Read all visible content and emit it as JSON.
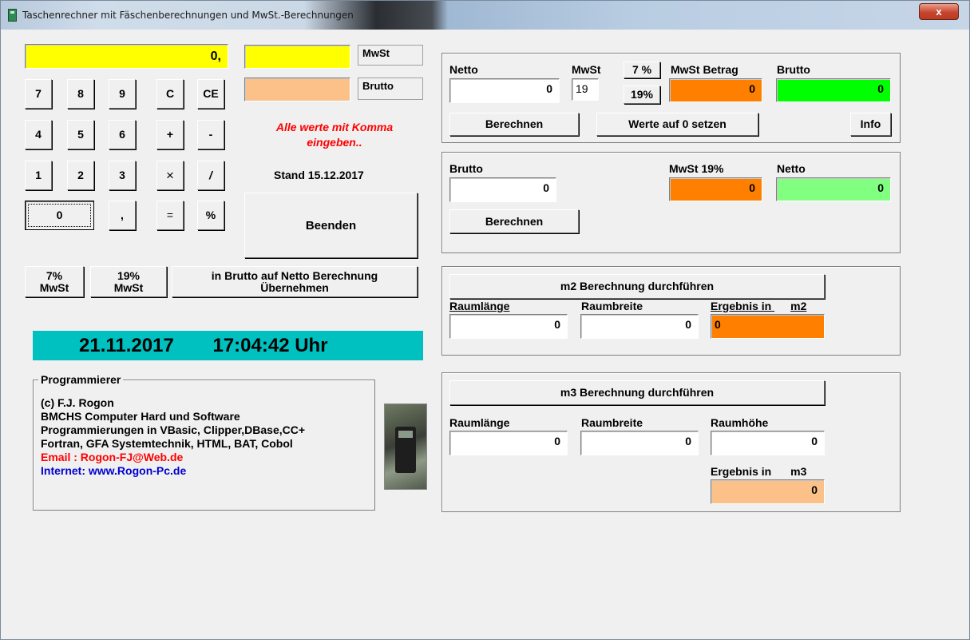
{
  "window": {
    "title": "Taschenrechner mit Fäschenberechnungen und MwSt.-Berechnungen",
    "close_glyph": "x"
  },
  "calculator": {
    "display": "0,",
    "keys": [
      "7",
      "8",
      "9",
      "C",
      "CE",
      "4",
      "5",
      "6",
      "+",
      "-",
      "1",
      "2",
      "3",
      "×",
      "/",
      "0",
      ",",
      "=",
      "%"
    ]
  },
  "side": {
    "mwst_label": "MwSt",
    "brutto_label": "Brutto",
    "note": "Alle werte mit Komma eingeben..",
    "stand": "Stand 15.12.2017",
    "beenden": "Beenden"
  },
  "quick": {
    "btn7": "7% MwSt",
    "btn19": "19% MwSt",
    "transfer": "in Brutto auf Netto Berechnung Übernehmen"
  },
  "clock": {
    "date": "21.11.2017",
    "time": "17:04:42 Uhr"
  },
  "programmer": {
    "legend": "Programmierer",
    "lines": [
      "(c) F.J. Rogon",
      "BMCHS Computer Hard und Software",
      "Programmierungen in VBasic, Clipper,DBase,CC+",
      "Fortran, GFA Systemtechnik, HTML, BAT, Cobol"
    ],
    "email": "Email   : Rogon-FJ@Web.de",
    "internet": "Internet: www.Rogon-Pc.de"
  },
  "netto_panel": {
    "netto_label": "Netto",
    "netto_value": "0",
    "mwst_label": "MwSt",
    "mwst_value": "19",
    "btn7": "7 %",
    "btn19": "19%",
    "mwst_betrag_label": "MwSt Betrag",
    "mwst_betrag_value": "0",
    "brutto_label": "Brutto",
    "brutto_value": "0",
    "berechnen": "Berechnen",
    "reset": "Werte auf 0 setzen",
    "info": "Info"
  },
  "brutto_panel": {
    "brutto_label": "Brutto",
    "brutto_value": "0",
    "mwst_label": "MwSt 19%",
    "mwst_value": "0",
    "netto_label": "Netto",
    "netto_value": "0",
    "berechnen": "Berechnen"
  },
  "m2_panel": {
    "button": "m2 Berechnung durchführen",
    "laenge_label": "Raumlänge",
    "laenge_value": "0",
    "breite_label": "Raumbreite",
    "breite_value": "0",
    "ergebnis_label": "Ergebnis in",
    "unit": "m2",
    "ergebnis_value": "0"
  },
  "m3_panel": {
    "button": "m3 Berechnung durchführen",
    "laenge_label": "Raumlänge",
    "laenge_value": "0",
    "breite_label": "Raumbreite",
    "breite_value": "0",
    "hoehe_label": "Raumhöhe",
    "hoehe_value": "0",
    "ergebnis_label": "Ergebnis in",
    "unit": "m3",
    "ergebnis_value": "0"
  },
  "colors": {
    "yellow": "#ffff00",
    "peach": "#fbc189",
    "orange": "#ff7f00",
    "green": "#00ff00",
    "lightgreen": "#80ff80",
    "teal": "#00c0c0",
    "red_text": "#ff0000",
    "blue_text": "#0000d0"
  }
}
